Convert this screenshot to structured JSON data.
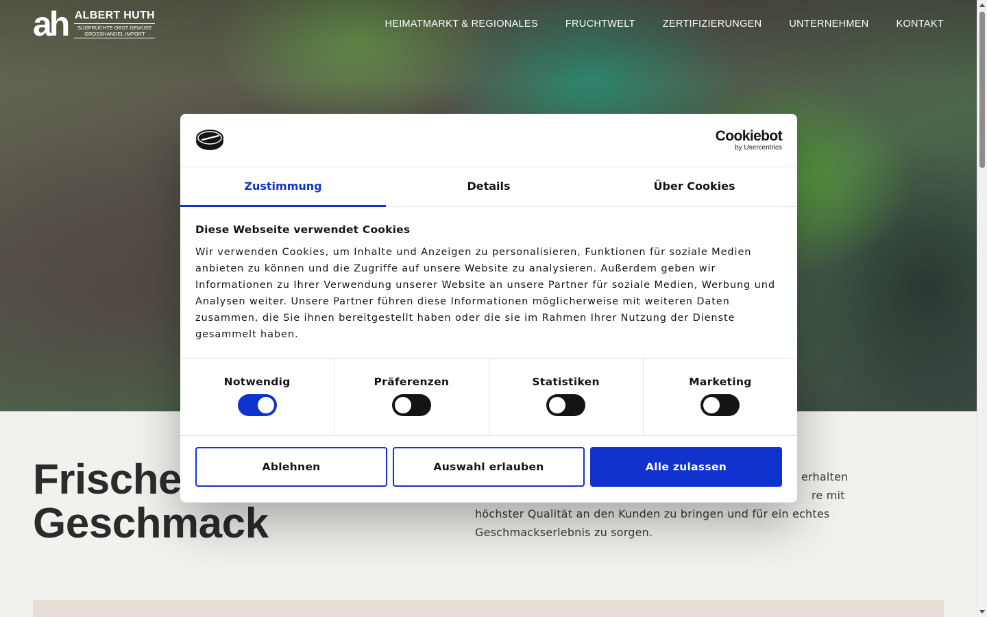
{
  "header": {
    "logo": {
      "mark": "ah",
      "name": "ALBERT HUTH",
      "sub1": "SÜDFRÜCHTE OBST GEMÜSE",
      "sub2": "GROSSHANDEL IMPORT"
    },
    "nav": [
      "HEIMATMARKT & REGIONALES",
      "FRUCHTWELT",
      "ZERTIFIZIERUNGEN",
      "UNTERNEHMEN",
      "KONTAKT"
    ]
  },
  "main": {
    "headline_line1": "Frische",
    "headline_line2": "Geschmack",
    "intro_line1": "erhalten",
    "intro_line2": "re mit",
    "intro_line3": "höchster Qualität an den Kunden zu bringen und für ein echtes",
    "intro_line4": "Geschmackserlebnis zu sorgen."
  },
  "cookie_dialog": {
    "brand_name": "Cookiebot",
    "brand_by": "by Usercentrics",
    "tabs": [
      {
        "label": "Zustimmung",
        "active": true
      },
      {
        "label": "Details",
        "active": false
      },
      {
        "label": "Über Cookies",
        "active": false
      }
    ],
    "title": "Diese Webseite verwendet Cookies",
    "text": "Wir verwenden Cookies, um Inhalte und Anzeigen zu personalisieren, Funktionen für soziale Medien anbieten zu können und die Zugriffe auf unsere Website zu analysieren. Außerdem geben wir Informationen zu Ihrer Verwendung unserer Website an unsere Partner für soziale Medien, Werbung und Analysen weiter. Unsere Partner führen diese Informationen möglicherweise mit weiteren Daten zusammen, die Sie ihnen bereitgestellt haben oder die sie im Rahmen Ihrer Nutzung der Dienste gesammelt haben.",
    "toggles": [
      {
        "label": "Notwendig",
        "on": true
      },
      {
        "label": "Präferenzen",
        "on": false
      },
      {
        "label": "Statistiken",
        "on": false
      },
      {
        "label": "Marketing",
        "on": false
      }
    ],
    "buttons": {
      "decline": "Ablehnen",
      "allow_selection": "Auswahl erlauben",
      "allow_all": "Alle zulassen"
    },
    "colors": {
      "accent": "#1032cf",
      "toggle_off": "#141414"
    }
  }
}
